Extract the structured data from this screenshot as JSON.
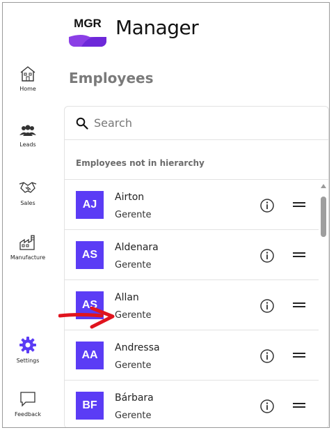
{
  "app": {
    "logo_text": "MGR",
    "title": "Manager"
  },
  "sidebar": {
    "items": [
      {
        "label": "Home",
        "icon": "home-icon"
      },
      {
        "label": "Leads",
        "icon": "people-icon"
      },
      {
        "label": "Sales",
        "icon": "handshake-icon"
      },
      {
        "label": "Manufacture",
        "icon": "factory-icon"
      },
      {
        "label": "Settings",
        "icon": "gear-icon"
      },
      {
        "label": "Feedback",
        "icon": "chat-icon"
      }
    ]
  },
  "page": {
    "title": "Employees",
    "search": {
      "placeholder": "Search",
      "value": ""
    },
    "section_label": "Employees not in hierarchy",
    "employees": [
      {
        "initials": "AJ",
        "name": "Airton",
        "role": "Gerente"
      },
      {
        "initials": "AS",
        "name": "Aldenara",
        "role": "Gerente"
      },
      {
        "initials": "AS",
        "name": "Allan",
        "role": "Gerente"
      },
      {
        "initials": "AA",
        "name": "Andressa",
        "role": "Gerente"
      },
      {
        "initials": "BF",
        "name": "Bárbara",
        "role": "Gerente"
      }
    ]
  },
  "colors": {
    "accent": "#5b3cf5",
    "logo_purple": "#8b3fe6",
    "settings_active": "#5b3cf5",
    "annotation_arrow": "#e0141e"
  }
}
